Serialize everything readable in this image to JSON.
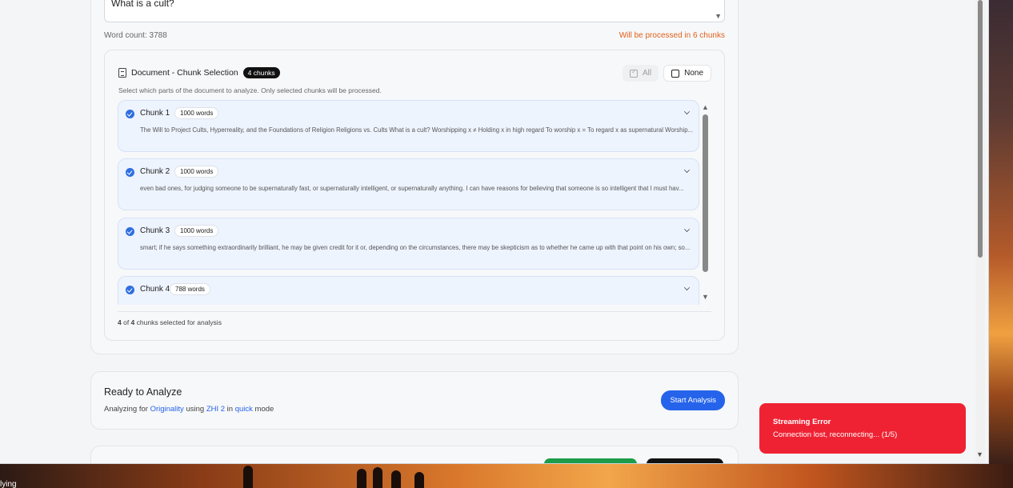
{
  "question": {
    "value": "What is a cult?"
  },
  "word_count": "Word count: 3788",
  "process_note": "Will be processed in 6 chunks",
  "chunk_panel": {
    "title": "Document - Chunk Selection",
    "count_badge": "4 chunks",
    "select_all_label": "All",
    "select_none_label": "None",
    "hint": "Select which parts of the document to analyze. Only selected chunks will be processed.",
    "chunks": [
      {
        "title": "Chunk 1",
        "words": "1000 words",
        "preview": "The Will to Project Cults, Hyperreality, and the Foundations of Religion Religions vs. Cults What is a cult? Worshipping x ≠ Holding x in high regard To worship x = To regard x as supernatural Worship..."
      },
      {
        "title": "Chunk 2",
        "words": "1000 words",
        "preview": "even bad ones, for judging someone to be supernaturally fast, or supernaturally intelligent, or supernaturally anything. I can have reasons for believing that someone is so intelligent that I must hav..."
      },
      {
        "title": "Chunk 3",
        "words": "1000 words",
        "preview": "smart; if he says something extraordinarily brilliant, he may be given credit for it or, depending on the circumstances, there may be skepticism as to whether he came up with that point on his own; so..."
      },
      {
        "title": "Chunk 4",
        "words": "788 words",
        "preview": ""
      }
    ],
    "footer": {
      "selected": "4",
      "of_text": " of ",
      "total": "4",
      "suffix": " chunks selected for analysis"
    }
  },
  "ready": {
    "title": "Ready to Analyze",
    "prefix": "Analyzing for ",
    "metric": "Originality",
    "using": " using ",
    "model": "ZHI 2",
    "in": " in ",
    "mode": "quick",
    "suffix": " mode",
    "start_label": "Start Analysis"
  },
  "toast": {
    "title": "Streaming Error",
    "message": "Connection lost, reconnecting... (1/5)"
  },
  "taskbar_text": "lying",
  "colors": {
    "accent": "#2563eb",
    "warning": "#e0601c",
    "error": "#ef2233"
  }
}
